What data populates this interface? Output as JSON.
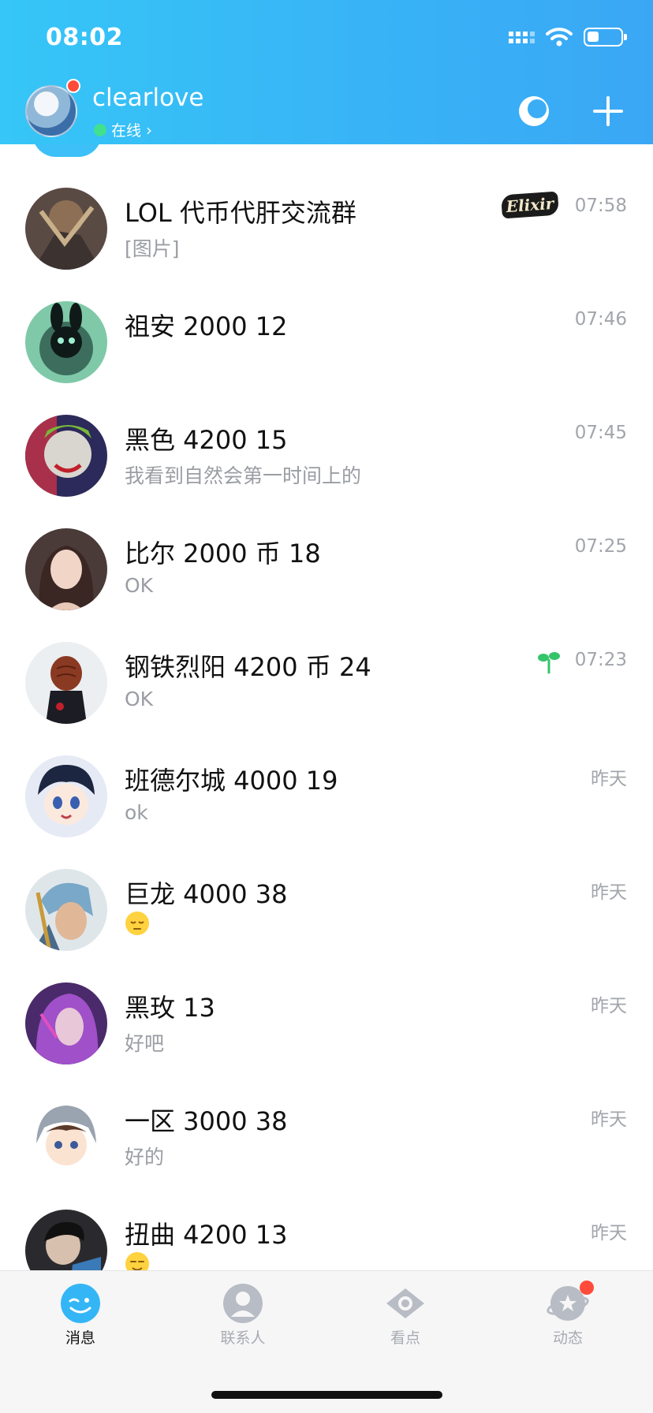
{
  "status_bar": {
    "time": "08:02"
  },
  "profile": {
    "name": "clearlove",
    "status": "在线",
    "has_badge": true
  },
  "colors": {
    "header": "#38b4f6",
    "online": "#41e08f",
    "badge": "#ff4b3a"
  },
  "conversations": [
    {
      "title": "LOL 代币代肝交流群",
      "preview": "[图片]",
      "time": "07:58",
      "tag": "Elixir"
    },
    {
      "title": "祖安 2000 12",
      "preview": "",
      "time": "07:46"
    },
    {
      "title": "黑色 4200 15",
      "preview": "我看到自然会第一时间上的",
      "time": "07:45"
    },
    {
      "title": "比尔 2000 币 18",
      "preview": "OK",
      "time": "07:25"
    },
    {
      "title": "钢铁烈阳 4200 币 24",
      "preview": "OK",
      "time": "07:23",
      "icon": "sprout-icon"
    },
    {
      "title": "班德尔城 4000 19",
      "preview": "ok",
      "time": "昨天"
    },
    {
      "title": "巨龙 4000 38",
      "preview": "",
      "time": "昨天",
      "emoji": "sleepy-face-icon"
    },
    {
      "title": "黑玫 13",
      "preview": "好吧",
      "time": "昨天"
    },
    {
      "title": "一区 3000 38",
      "preview": "好的",
      "time": "昨天"
    },
    {
      "title": "扭曲 4200 13",
      "preview": "",
      "time": "昨天",
      "emoji": "smile-face-icon"
    }
  ],
  "tabs": [
    {
      "label": "消息",
      "icon": "chat-face-icon",
      "active": true
    },
    {
      "label": "联系人",
      "icon": "contacts-icon",
      "active": false
    },
    {
      "label": "看点",
      "icon": "eye-icon",
      "active": false
    },
    {
      "label": "动态",
      "icon": "planet-star-icon",
      "active": false,
      "badge": true
    }
  ]
}
